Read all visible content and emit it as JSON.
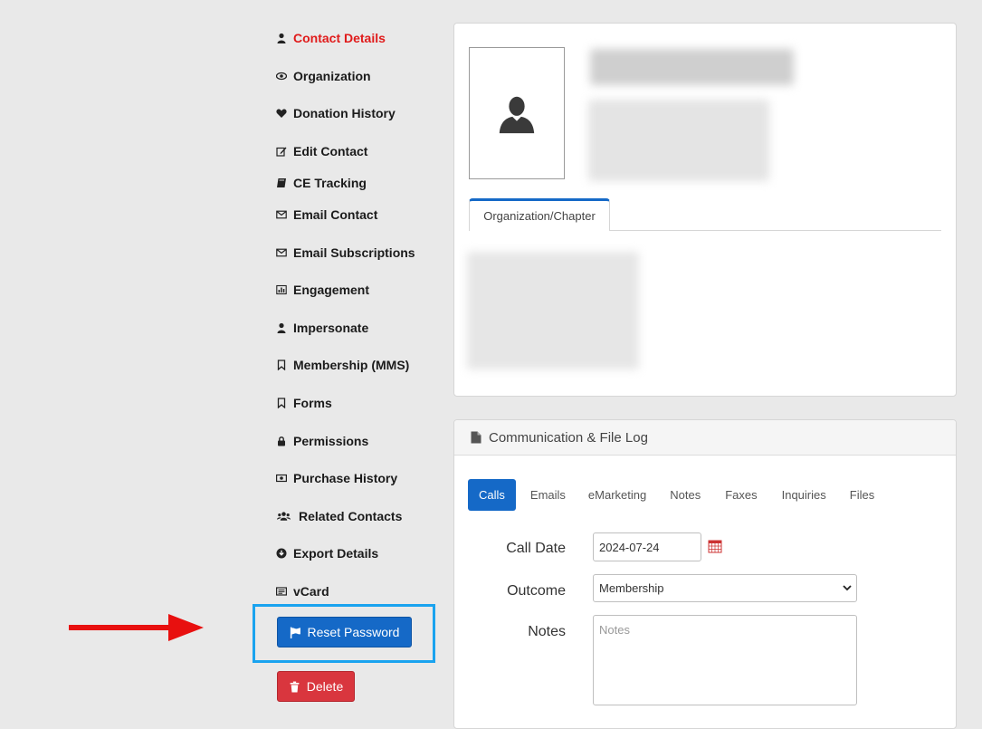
{
  "sidebar": {
    "items": [
      {
        "label": "Contact Details",
        "icon": "user-icon",
        "active": true
      },
      {
        "label": "Organization",
        "icon": "eye-icon"
      },
      {
        "label": "Donation History",
        "icon": "heart-icon"
      },
      {
        "label": "Edit Contact",
        "icon": "edit-icon"
      },
      {
        "label": "CE Tracking",
        "icon": "book-icon"
      },
      {
        "label": "Email Contact",
        "icon": "envelope-icon"
      },
      {
        "label": "Email Subscriptions",
        "icon": "envelope-icon"
      },
      {
        "label": "Engagement",
        "icon": "bar-chart-icon"
      },
      {
        "label": "Impersonate",
        "icon": "user-icon"
      },
      {
        "label": "Membership (MMS)",
        "icon": "bookmark-icon"
      },
      {
        "label": "Forms",
        "icon": "bookmark-icon"
      },
      {
        "label": "Permissions",
        "icon": "lock-icon"
      },
      {
        "label": "Purchase History",
        "icon": "money-icon"
      },
      {
        "label": "Related Contacts",
        "icon": "users-icon"
      },
      {
        "label": "Export Details",
        "icon": "download-icon"
      },
      {
        "label": "vCard",
        "icon": "vcard-icon"
      }
    ],
    "reset_password_label": "Reset Password",
    "delete_label": "Delete"
  },
  "profile": {
    "org_tab_label": "Organization/Chapter"
  },
  "log": {
    "title": "Communication & File Log",
    "tabs": [
      "Calls",
      "Emails",
      "eMarketing",
      "Notes",
      "Faxes",
      "Inquiries",
      "Files"
    ],
    "active_tab": "Calls",
    "call_date_label": "Call Date",
    "call_date_value": "2024-07-24",
    "outcome_label": "Outcome",
    "outcome_value": "Membership",
    "notes_label": "Notes",
    "notes_placeholder": "Notes"
  },
  "colors": {
    "active_nav": "#e01b1b",
    "primary": "#1569c7",
    "danger": "#d9363e",
    "highlight": "#1aa3ef",
    "arrow": "#e8100f"
  }
}
